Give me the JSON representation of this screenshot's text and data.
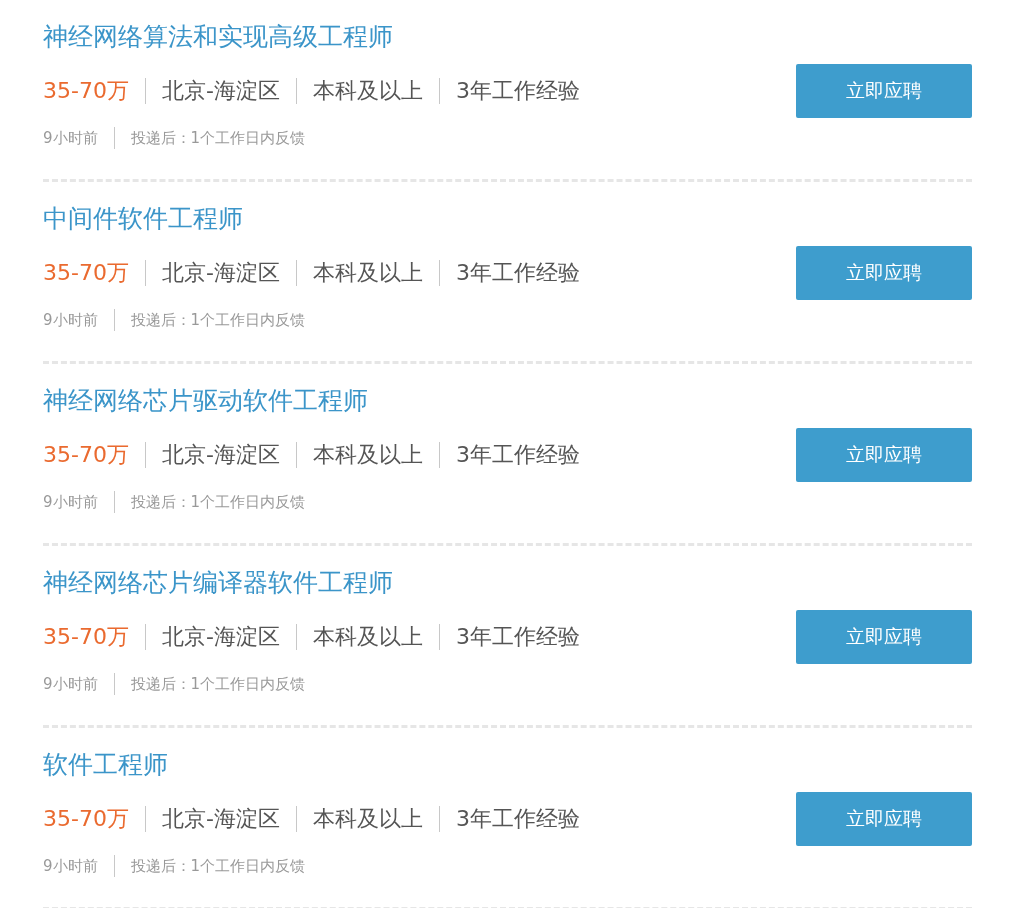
{
  "jobs": [
    {
      "title": "神经网络算法和实现高级工程师",
      "salary": "35-70万",
      "location": "北京-海淀区",
      "education": "本科及以上",
      "experience": "3年工作经验",
      "posted": "9小时前",
      "feedback": "投递后：1个工作日内反馈",
      "button": "立即应聘"
    },
    {
      "title": "中间件软件工程师",
      "salary": "35-70万",
      "location": "北京-海淀区",
      "education": "本科及以上",
      "experience": "3年工作经验",
      "posted": "9小时前",
      "feedback": "投递后：1个工作日内反馈",
      "button": "立即应聘"
    },
    {
      "title": "神经网络芯片驱动软件工程师",
      "salary": "35-70万",
      "location": "北京-海淀区",
      "education": "本科及以上",
      "experience": "3年工作经验",
      "posted": "9小时前",
      "feedback": "投递后：1个工作日内反馈",
      "button": "立即应聘"
    },
    {
      "title": "神经网络芯片编译器软件工程师",
      "salary": "35-70万",
      "location": "北京-海淀区",
      "education": "本科及以上",
      "experience": "3年工作经验",
      "posted": "9小时前",
      "feedback": "投递后：1个工作日内反馈",
      "button": "立即应聘"
    },
    {
      "title": "软件工程师",
      "salary": "35-70万",
      "location": "北京-海淀区",
      "education": "本科及以上",
      "experience": "3年工作经验",
      "posted": "9小时前",
      "feedback": "投递后：1个工作日内反馈",
      "button": "立即应聘"
    }
  ]
}
